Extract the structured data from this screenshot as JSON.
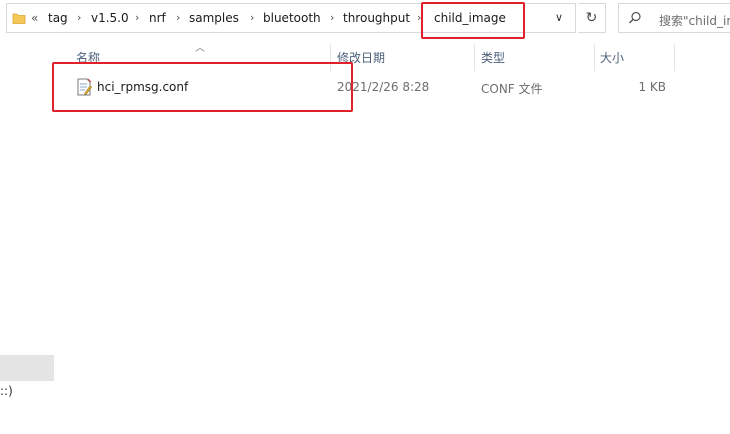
{
  "address_bar": {
    "overflow": "«",
    "crumbs": [
      "tag",
      "v1.5.0",
      "nrf",
      "samples",
      "bluetooth",
      "throughput",
      "child_image"
    ],
    "separator": "›",
    "dropdown": "∨",
    "refresh": "↻"
  },
  "search": {
    "placeholder": "搜索\"child_image\""
  },
  "nav": {
    "partial_label": "::)"
  },
  "columns": {
    "name": "名称",
    "date": "修改日期",
    "type": "类型",
    "size": "大小"
  },
  "files": [
    {
      "name": "hci_rpmsg.conf",
      "modified": "2021/2/26 8:28",
      "type": "CONF 文件",
      "size": "1 KB"
    }
  ],
  "colors": {
    "highlight": "#e0202a",
    "header_text": "#4c607a",
    "secondary_text": "#6d6d6d"
  }
}
